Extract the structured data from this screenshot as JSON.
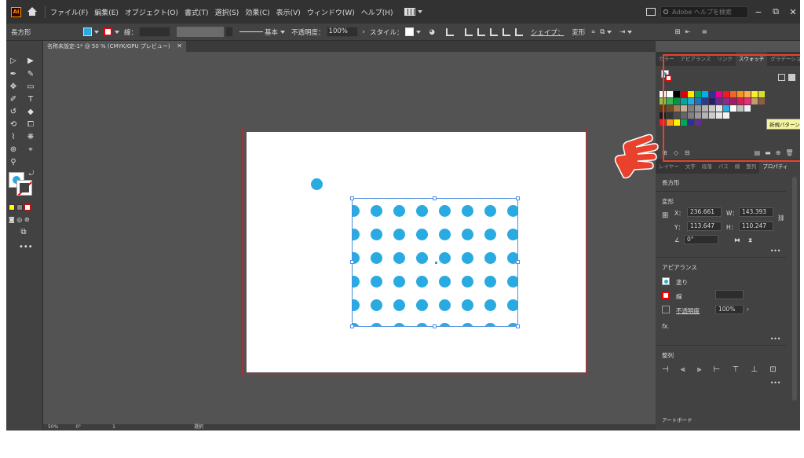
{
  "app": {
    "logo": "Ai"
  },
  "menu": {
    "items": [
      "ファイル(F)",
      "編集(E)",
      "オブジェクト(O)",
      "書式(T)",
      "選択(S)",
      "効果(C)",
      "表示(V)",
      "ウィンドウ(W)",
      "ヘルプ(H)"
    ],
    "search_placeholder": "Adobe ヘルプを検索",
    "minimize": "−",
    "restore": "⧉",
    "close": "✕"
  },
  "control": {
    "object_type": "長方形",
    "stroke_label": "線：",
    "stroke_style": "基本",
    "opacity_label": "不透明度：",
    "opacity_value": "100%",
    "style_label": "スタイル：",
    "shape_label": "シェイプ：",
    "transform_label": "変形"
  },
  "document": {
    "tab_title": "名称未設定-1* @ 50 % (CMYK/GPU プレビュー)",
    "close": "✕"
  },
  "swatches_panel": {
    "tabs": [
      "カラー",
      "アピアランス",
      "リンク",
      "スウォッチ",
      "グラデーション"
    ],
    "active_tab": "スウォッチ",
    "tooltip": "新規パターン",
    "rows": [
      [
        "#ffffff",
        "#ffffff",
        "#000000",
        "#e00000",
        "#ffea00",
        "#00a651",
        "#00aeef",
        "#2e3192",
        "#ec008c",
        "#ed1c24",
        "#f26522",
        "#f7941d",
        "#fbb040",
        "#f9ed32",
        "#d7df23"
      ],
      [
        "#8dc63f",
        "#39b54a",
        "#009444",
        "#00a79d",
        "#27aae1",
        "#1c75bc",
        "#2b3990",
        "#262262",
        "#662d91",
        "#92278f",
        "#9e1f63",
        "#da1c5c",
        "#ee2a7b",
        "#c49a6c",
        "#8b5e3c"
      ],
      [
        "#603913",
        "#754c29",
        "#a97c50",
        "#c7b299",
        "#808080",
        "#999999",
        "#b3b3b3",
        "#cccccc",
        "#e6e6e6",
        "#29abe2",
        "#ffffff",
        "#bfbfbf",
        "#f0f0f0"
      ],
      [
        "#1a1a1a",
        "#333333",
        "#4d4d4d",
        "#666666",
        "#808080",
        "#999999",
        "#b3b3b3",
        "#cccccc",
        "#e6e6e6",
        "#f2f2f2"
      ],
      [
        "#ed1c24",
        "#f7941d",
        "#fff200",
        "#00a651",
        "#2e3192",
        "#662d91"
      ]
    ],
    "accent_border": "#e8412c"
  },
  "props_panel": {
    "tabs": [
      "レイヤー",
      "文字",
      "段落",
      "パス",
      "線",
      "整列",
      "プロパティ"
    ],
    "active_tab": "プロパティ",
    "object_type": "長方形",
    "transform_title": "変形",
    "x_label": "X：",
    "x_value": "236.661",
    "w_label": "W：",
    "w_value": "143.393",
    "y_label": "Y：",
    "y_value": "113.647",
    "h_label": "H：",
    "h_value": "110.247",
    "angle_value": "0°",
    "appearance_title": "アピアランス",
    "fill_label": "塗り",
    "stroke_label": "線",
    "opacity_label": "不透明度",
    "opacity_value": "100%",
    "fx_label": "fx.",
    "align_title": "整列",
    "more": "•••"
  },
  "artboards_panel": {
    "title": "アートボード"
  },
  "status": {
    "zoom": "50%",
    "angle": "0°",
    "artboard": "1",
    "mode": "選択"
  },
  "colors": {
    "accent_blue": "#29abe2",
    "frame_red": "#c1272d",
    "highlight_red": "#e8412c"
  }
}
